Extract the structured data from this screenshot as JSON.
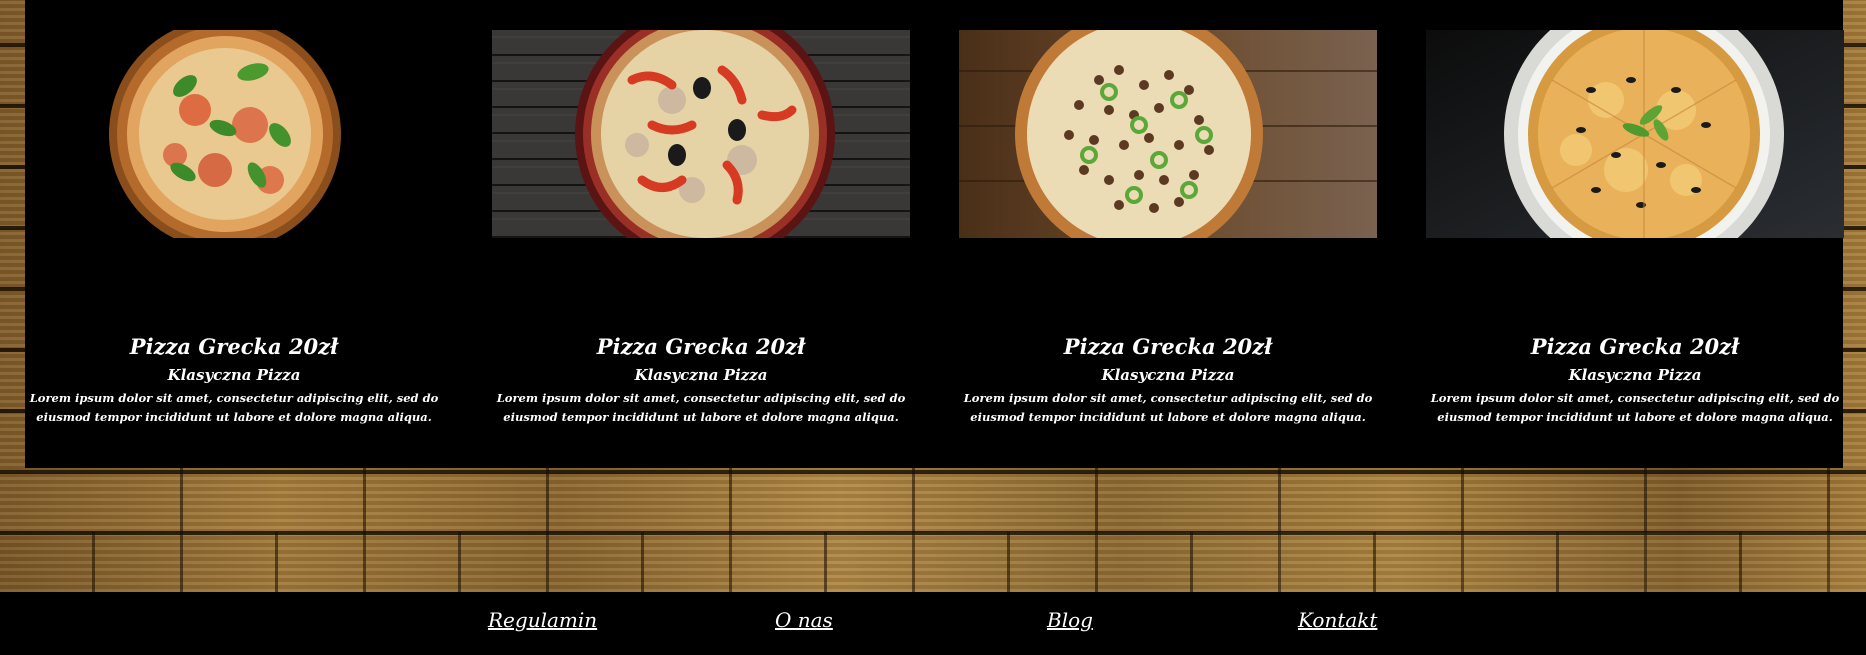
{
  "products": [
    {
      "image_icon": "pizza-margherita-image",
      "name": "Pizza Grecka 20zł",
      "subtitle": "Klasyczna Pizza",
      "description": "Lorem ipsum dolor sit amet, consectetur adipiscing elit, sed do eiusmod tempor incididunt ut labore et dolore magna aliqua."
    },
    {
      "image_icon": "pizza-peppers-image",
      "name": "Pizza Grecka 20zł",
      "subtitle": "Klasyczna Pizza",
      "description": "Lorem ipsum dolor sit amet, consectetur adipiscing elit, sed do eiusmod tempor incididunt ut labore et dolore magna aliqua."
    },
    {
      "image_icon": "pizza-meat-jalapeno-image",
      "name": "Pizza Grecka 20zł",
      "subtitle": "Klasyczna Pizza",
      "description": "Lorem ipsum dolor sit amet, consectetur adipiscing elit, sed do eiusmod tempor incididunt ut labore et dolore magna aliqua."
    },
    {
      "image_icon": "pizza-olives-image",
      "name": "Pizza Grecka 20zł",
      "subtitle": "Klasyczna Pizza",
      "description": "Lorem ipsum dolor sit amet, consectetur adipiscing elit, sed do eiusmod tempor incididunt ut labore et dolore magna aliqua."
    }
  ],
  "footer": {
    "links": [
      "Regulamin",
      "O nas",
      "Blog",
      "Kontakt"
    ]
  },
  "colors": {
    "background": "#000000",
    "text": "#ffffff",
    "wood": "#9c7638"
  }
}
